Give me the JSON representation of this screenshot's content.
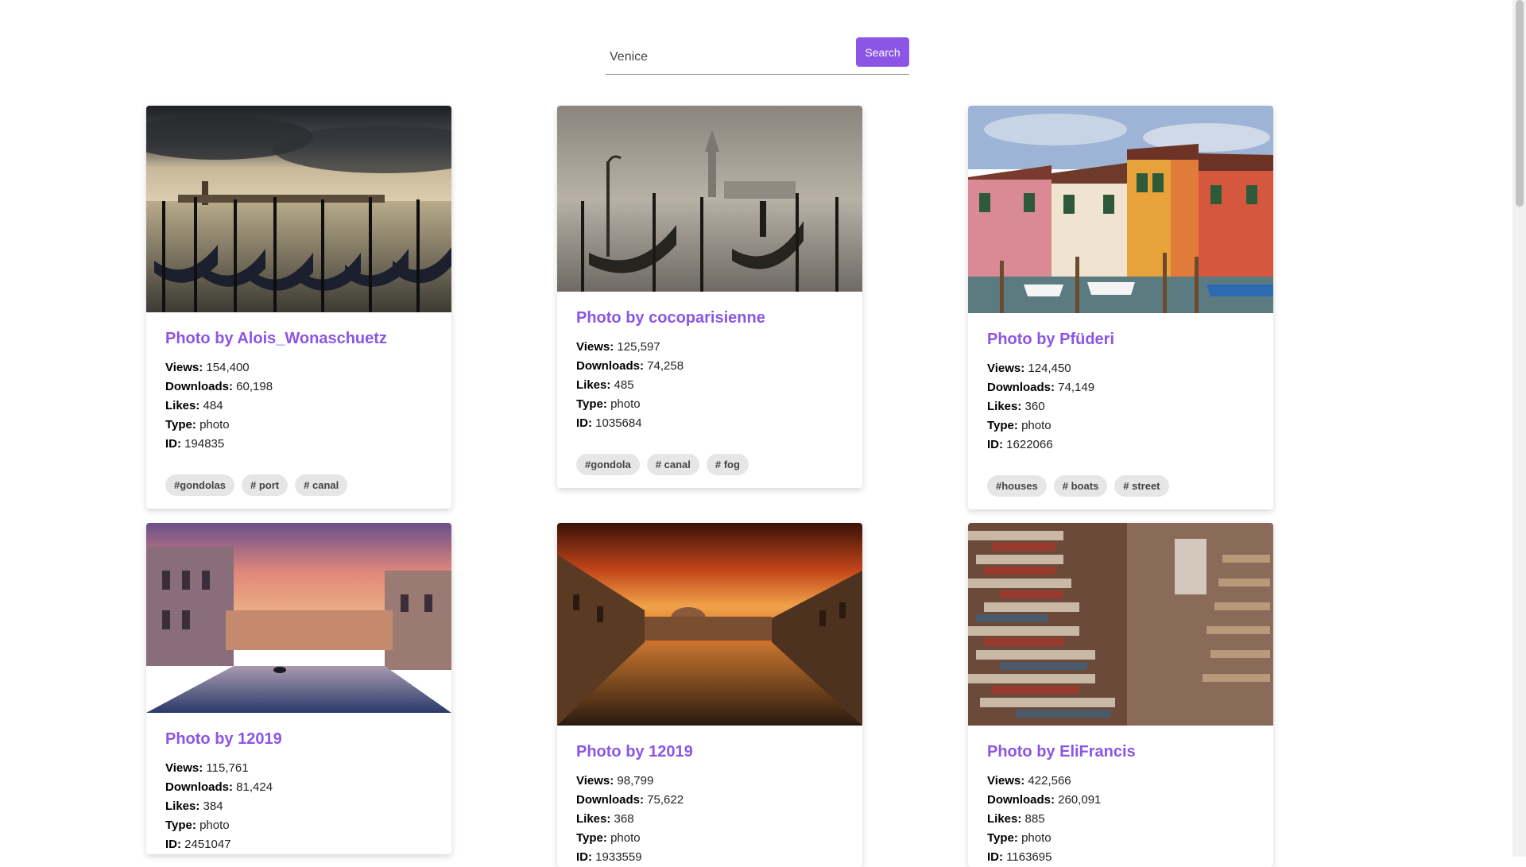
{
  "search": {
    "value": "Venice",
    "button_label": "Search"
  },
  "cards": [
    {
      "title": "Photo by Alois_Wonaschuetz",
      "views": "154,400",
      "downloads": "60,198",
      "likes": "484",
      "type": "photo",
      "id": "194835",
      "tags": [
        "#gondolas",
        "# port",
        "# canal"
      ]
    },
    {
      "title": "Photo by cocoparisienne",
      "views": "125,597",
      "downloads": "74,258",
      "likes": "485",
      "type": "photo",
      "id": "1035684",
      "tags": [
        "#gondola",
        "# canal",
        "# fog"
      ]
    },
    {
      "title": "Photo by Pfüderi",
      "views": "124,450",
      "downloads": "74,149",
      "likes": "360",
      "type": "photo",
      "id": "1622066",
      "tags": [
        "#houses",
        "# boats",
        "# street"
      ]
    },
    {
      "title": "Photo by 12019",
      "views": "115,761",
      "downloads": "81,424",
      "likes": "384",
      "type": "photo",
      "id": "2451047",
      "tags": []
    },
    {
      "title": "Photo by 12019",
      "views": "98,799",
      "downloads": "75,622",
      "likes": "368",
      "type": "photo",
      "id": "1933559",
      "tags": []
    },
    {
      "title": "Photo by EliFrancis",
      "views": "422,566",
      "downloads": "260,091",
      "likes": "885",
      "type": "photo",
      "id": "1163695",
      "tags": []
    }
  ],
  "labels": {
    "views": "Views:",
    "downloads": "Downloads:",
    "likes": "Likes:",
    "type": "Type:",
    "id": "ID:"
  }
}
